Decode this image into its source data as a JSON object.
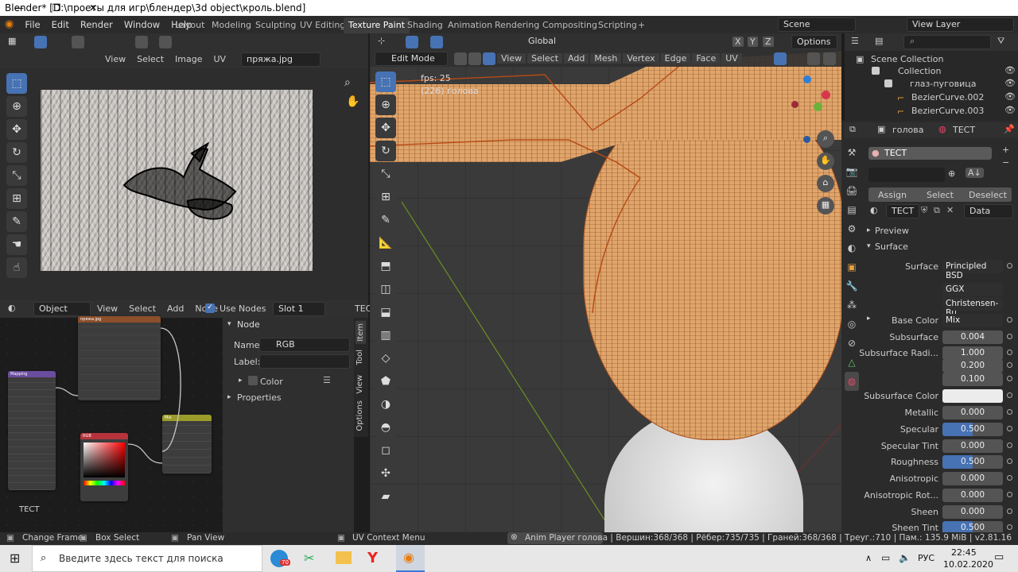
{
  "window": {
    "title": "Blender* [D:\\проеты для игр\\блендер\\3d object\\кроль.blend]",
    "controls": [
      "—",
      "❐",
      "✕"
    ]
  },
  "menu": [
    "File",
    "Edit",
    "Render",
    "Window",
    "Help"
  ],
  "workspaces": [
    "Layout",
    "Modeling",
    "Sculpting",
    "UV Editing",
    "Texture Paint",
    "Shading",
    "Animation",
    "Rendering",
    "Compositing",
    "Scripting",
    "+"
  ],
  "active_workspace": "Texture Paint",
  "scene": "Scene",
  "view_layer": "View Layer",
  "uv_editor": {
    "menus": [
      "View",
      "Select",
      "Image",
      "UV"
    ],
    "image": "пряжа.jpg"
  },
  "node_editor": {
    "object": "Object",
    "menus": [
      "View",
      "Select",
      "Add",
      "Node"
    ],
    "use_nodes": "Use Nodes",
    "slot": "Slot 1",
    "material_short": "ТЕС",
    "material": "ТЕСТ",
    "node_panel": {
      "title": "Node",
      "name_label": "Name:",
      "name": "RGB",
      "label_label": "Label:",
      "color": "Color",
      "properties": "Properties",
      "tabs": [
        "Item",
        "Tool",
        "View",
        "Options"
      ]
    },
    "nodes": {
      "image": "пряжа.jpg",
      "mapping": "Mapping",
      "rgb": "RGB",
      "mix": "Mix"
    }
  },
  "viewport": {
    "mode": "Edit Mode",
    "menus": [
      "View",
      "Select",
      "Add",
      "Mesh",
      "Vertex",
      "Edge",
      "Face",
      "UV"
    ],
    "orientation": "Global",
    "options": "Options",
    "fps": "fps: 25",
    "object_info": "(226) голова",
    "axes": [
      "X",
      "Y",
      "Z"
    ]
  },
  "outliner": {
    "search": "",
    "items": [
      "Scene Collection",
      "Collection",
      "глаз-пуговица",
      "BezierCurve.002",
      "BezierCurve.003"
    ]
  },
  "properties": {
    "object": "голова",
    "material": "ТЕСТ",
    "slot": "ТЕСТ",
    "buttons": [
      "Assign",
      "Select",
      "Deselect"
    ],
    "link": "Data",
    "preview": "Preview",
    "surface_section": "Surface",
    "rows": [
      {
        "label": "Surface",
        "value": "Principled BSD",
        "kind": "text"
      },
      {
        "label": "",
        "value": "GGX",
        "kind": "select"
      },
      {
        "label": "",
        "value": "Christensen-Bu...",
        "kind": "select"
      },
      {
        "label": "Base Color",
        "value": "Mix",
        "kind": "text"
      },
      {
        "label": "Subsurface",
        "value": "0.004",
        "kind": "num"
      },
      {
        "label": "Subsurface Radi...",
        "value": "1.000",
        "kind": "num"
      },
      {
        "label": "",
        "value": "0.200",
        "kind": "num"
      },
      {
        "label": "",
        "value": "0.100",
        "kind": "num"
      },
      {
        "label": "Subsurface Color",
        "value": "",
        "kind": "color"
      },
      {
        "label": "Metallic",
        "value": "0.000",
        "kind": "num"
      },
      {
        "label": "Specular",
        "value": "0.500",
        "kind": "blue"
      },
      {
        "label": "Specular Tint",
        "value": "0.000",
        "kind": "num"
      },
      {
        "label": "Roughness",
        "value": "0.500",
        "kind": "blue"
      },
      {
        "label": "Anisotropic",
        "value": "0.000",
        "kind": "num"
      },
      {
        "label": "Anisotropic Rot...",
        "value": "0.000",
        "kind": "num"
      },
      {
        "label": "Sheen",
        "value": "0.000",
        "kind": "num"
      },
      {
        "label": "Sheen Tint",
        "value": "0.500",
        "kind": "blue"
      }
    ]
  },
  "status": {
    "change_frame": "Change Frame",
    "box_select": "Box Select",
    "pan_view": "Pan View",
    "uv_context": "UV Context Menu",
    "anim_player": "Anim Player",
    "info": "голова | Вершин:368/368 | Рёбер:735/735 | Граней:368/368 | Треуг.:710 | Пам.: 135.9 MiB | v2.81.16"
  },
  "taskbar": {
    "search_placeholder": "Введите здесь текст для поиска",
    "lang": "РУС",
    "time": "22:45",
    "date": "10.02.2020",
    "badge": "70"
  }
}
